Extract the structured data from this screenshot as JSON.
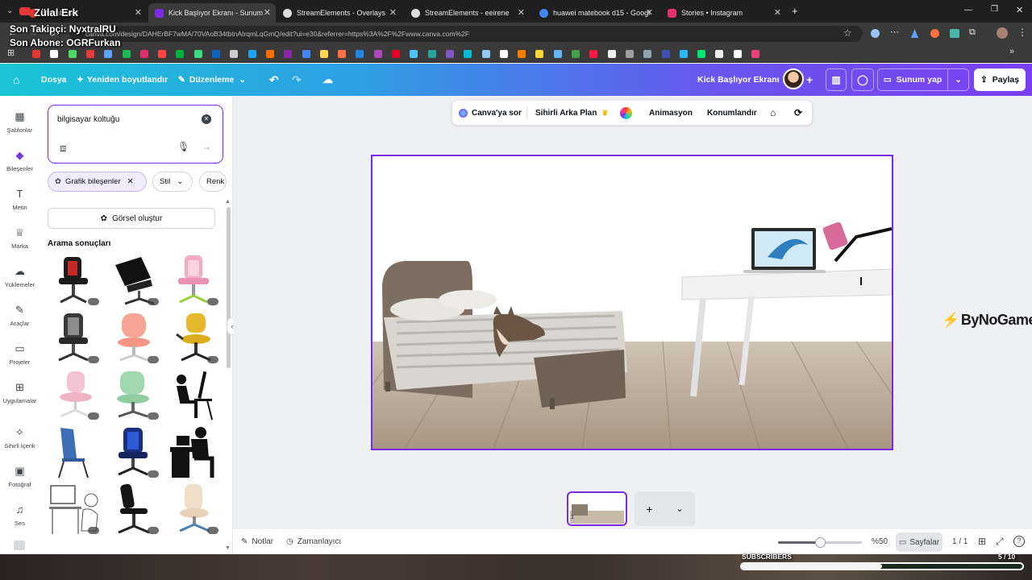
{
  "browser": {
    "tabs": [
      {
        "label": "Dashboard",
        "favicon_color": "#e53935"
      },
      {
        "label": "Kick Başlıyor Ekranı - Sunum",
        "favicon_color": "#7d2ae8"
      },
      {
        "label": "StreamElements - Overlays",
        "favicon_color": "#ffffff"
      },
      {
        "label": "StreamElements - eeirene",
        "favicon_color": "#ffffff"
      },
      {
        "label": "huawei matebook d15 - Googl",
        "favicon_color": "#4285f4"
      },
      {
        "label": "Stories • Instagram",
        "favicon_color": "#e1306c"
      }
    ],
    "url": "canva.com/design/DAHErBF7wMA/70VAoB34tbtnAIrqmLqGmQ/edit?ui=e30&referrer=https%3A%2F%2Fwww.canva.com%2F"
  },
  "stream_overlay": {
    "streamer_name": "Zülal Erk",
    "last_follower": "Son Takipçi: NyxtralRU",
    "last_sub": "Son Abone: OGRFurkan",
    "subscribers_label": "SUBSCRIBERS",
    "subscribers_count": "5 / 10",
    "subscribers_progress": 0.5
  },
  "canva_header": {
    "file": "Dosya",
    "resize": "Yeniden boyutlandır",
    "edit_mode": "Düzenleme",
    "doc_title": "Kick Başlıyor Ekranı",
    "present": "Sunum yap",
    "share": "Paylaş"
  },
  "rail": [
    {
      "label": "Şablonlar"
    },
    {
      "label": "Bileşenler"
    },
    {
      "label": "Metin"
    },
    {
      "label": "Marka"
    },
    {
      "label": "Yüklemeler"
    },
    {
      "label": "Araçlar"
    },
    {
      "label": "Projeler"
    },
    {
      "label": "Uygulamalar"
    },
    {
      "label": "Sihirli İçerik"
    },
    {
      "label": "Fotoğraf"
    },
    {
      "label": "Ses"
    }
  ],
  "panel": {
    "search_value": "bilgisayar koltuğu",
    "filter_chip": "Grafik bileşenler",
    "style_chip": "Stil",
    "color_chip": "Renk",
    "create_image": "Görsel oluştur",
    "results_heading": "Arama sonuçları"
  },
  "floatbar": {
    "ask": "Canva'ya sor",
    "magic_bg": "Sihirli Arka Plan",
    "animate": "Animasyon",
    "position": "Konumlandır"
  },
  "canvas": {
    "logo_text": "ByNoGame"
  },
  "bottombar": {
    "notes": "Notlar",
    "timer": "Zamanlayıcı",
    "zoom": "%50",
    "zoom_level": 0.5,
    "pages": "Sayfalar",
    "page_count": "1 / 1",
    "page_number": "1"
  }
}
